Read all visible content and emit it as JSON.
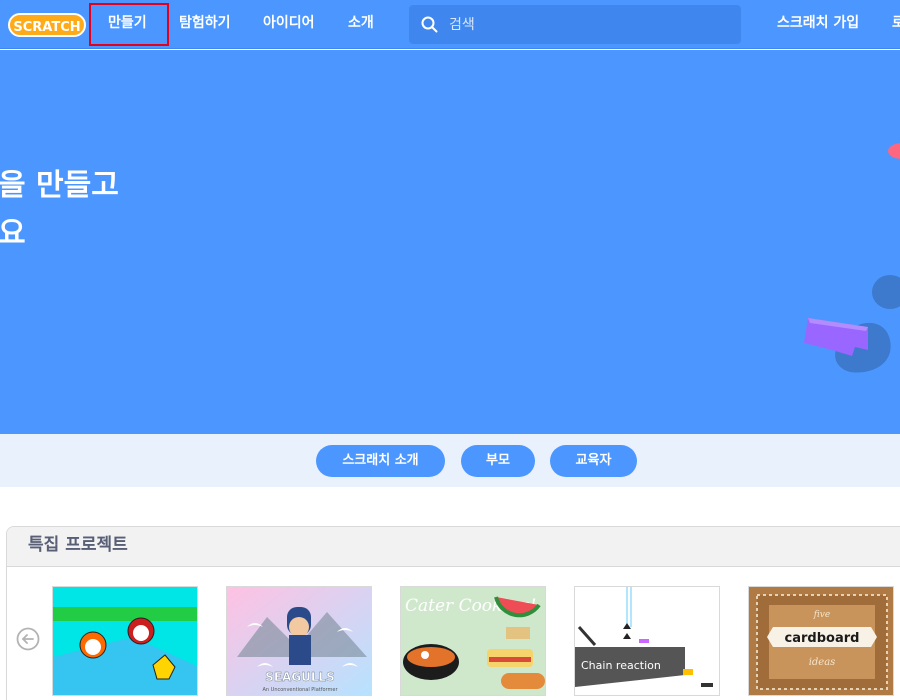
{
  "nav": {
    "logo_text": "SCRATCH",
    "items": [
      {
        "label": "만들기"
      },
      {
        "label": "탐험하기"
      },
      {
        "label": "아이디어"
      },
      {
        "label": "소개"
      }
    ],
    "search": {
      "placeholder": "검색",
      "value": ""
    },
    "join_label": "스크래치 가입",
    "signin_label": "로"
  },
  "hero": {
    "line1": "을 만들고",
    "line2": "요"
  },
  "intro": {
    "buttons": [
      {
        "label": "스크래치 소개"
      },
      {
        "label": "부모"
      },
      {
        "label": "교육자"
      }
    ]
  },
  "featured": {
    "title": "특집 프로젝트",
    "projects": [
      {
        "thumb": "cartoon-characters-pool"
      },
      {
        "thumb": "seagulls-platformer",
        "title_text": "SEAGULLS",
        "subtitle_text": "An Unconventional Platformer"
      },
      {
        "thumb": "cater-cooking",
        "title_text": "Cater Cooking!"
      },
      {
        "thumb": "chain-reaction",
        "title_text": "Chain reaction"
      },
      {
        "thumb": "cardboard-ideas",
        "title_text": "cardboard",
        "top_text": "five",
        "bottom_text": "ideas"
      }
    ]
  },
  "colors": {
    "brand_blue": "#4c97ff",
    "nav_border": "#3f87ee",
    "highlight_red": "#e3001b",
    "intro_bg": "#e9f1fc",
    "text_gray": "#575e75"
  }
}
